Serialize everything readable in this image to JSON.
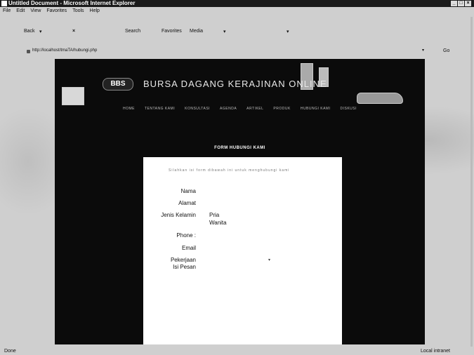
{
  "window": {
    "title": "Untitled Document - Microsoft Internet Explorer"
  },
  "menu": [
    "File",
    "Edit",
    "View",
    "Favorites",
    "Tools",
    "Help"
  ],
  "toolbar": {
    "back": "Back",
    "search": "Search",
    "favorites": "Favorites",
    "media": "Media"
  },
  "address": {
    "url": "http://localhost/tmaTA/hubungi.php",
    "go": "Go"
  },
  "site": {
    "logo": "BBS",
    "title": "BURSA DAGANG KERAJINAN ONLINE",
    "nav": [
      "HOME",
      "TENTANG KAMI",
      "KONSULTASI",
      "AGENDA",
      "ARTIKEL",
      "PRODUK",
      "HUBUNGI KAMI",
      "DISKUSI"
    ]
  },
  "form": {
    "heading": "FORM HUBUNGI KAMI",
    "intro": "Silahkan isi form dibawah ini untuk menghubungi kami",
    "labels": {
      "nama": "Nama",
      "alamat": "Alamat",
      "jenis_kelamin": "Jenis Kelamin",
      "phone": "Phone :",
      "email": "Email",
      "pekerjaan": "Pekerjaan",
      "isi_pesan": "Isi Pesan"
    },
    "gender_options": [
      "Pria",
      "Wanita"
    ]
  },
  "status": {
    "left": "Done",
    "right": "Local intranet"
  }
}
